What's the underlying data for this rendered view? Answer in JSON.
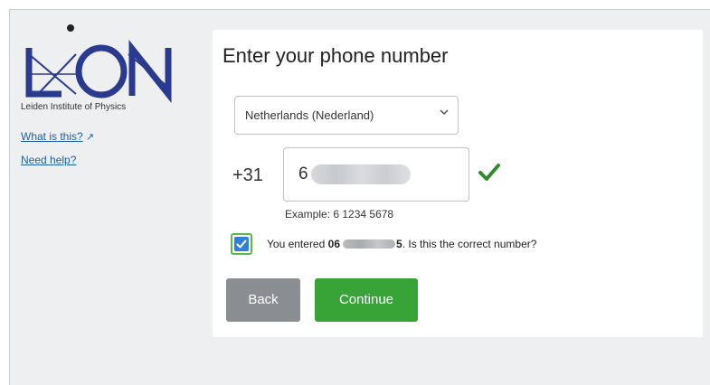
{
  "sidebar": {
    "logo_caption": "Leiden Institute of Physics",
    "what_is_this": "What is this?",
    "need_help": "Need help?"
  },
  "form": {
    "title": "Enter your phone number",
    "country_selected": "Netherlands (Nederland)",
    "country_prefix": "+31",
    "phone_value_visible": "6",
    "example_text": "Example: 6 1234 5678",
    "confirm_prefix": "You entered",
    "confirm_number_start": "06",
    "confirm_number_end": "5",
    "confirm_suffix": ". Is this the correct number?",
    "confirm_checked": true,
    "back_label": "Back",
    "continue_label": "Continue"
  },
  "icons": {
    "external_link": "external-link-icon",
    "chevron": "chevron-down-icon",
    "valid": "checkmark-icon"
  },
  "colors": {
    "logo_blue": "#2a3b8f",
    "link_blue": "#1a5fa8",
    "valid_green": "#2e8b2e",
    "continue_green": "#38a438",
    "back_gray": "#8a8d91",
    "checkbox_blue": "#2f7fd6"
  }
}
